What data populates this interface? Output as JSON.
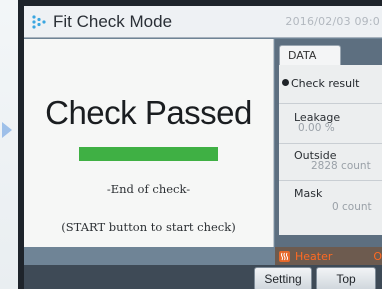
{
  "titlebar": {
    "title": "Fit Check Mode",
    "datetime": "2016/02/03 09:0",
    "icon": "app-dots-icon"
  },
  "main": {
    "status": "Check Passed",
    "progress": 1.0,
    "end_label": "-End of check-",
    "start_hint": "(START button to start check)"
  },
  "side": {
    "tab": "DATA",
    "check_result": "Check result",
    "metrics": [
      {
        "label": "Leakage",
        "value": "0.00 %"
      },
      {
        "label": "Outside",
        "value": "2828 count"
      },
      {
        "label": "Mask",
        "value": "0 count"
      }
    ],
    "heater_label": "Heater",
    "heater_status": "O",
    "heater_icon": "heater-icon"
  },
  "footer": {
    "setting_label": "Setting",
    "top_label": "Top"
  },
  "colors": {
    "progress_fill": "#3fb044",
    "heater_text": "#ff6a22"
  }
}
